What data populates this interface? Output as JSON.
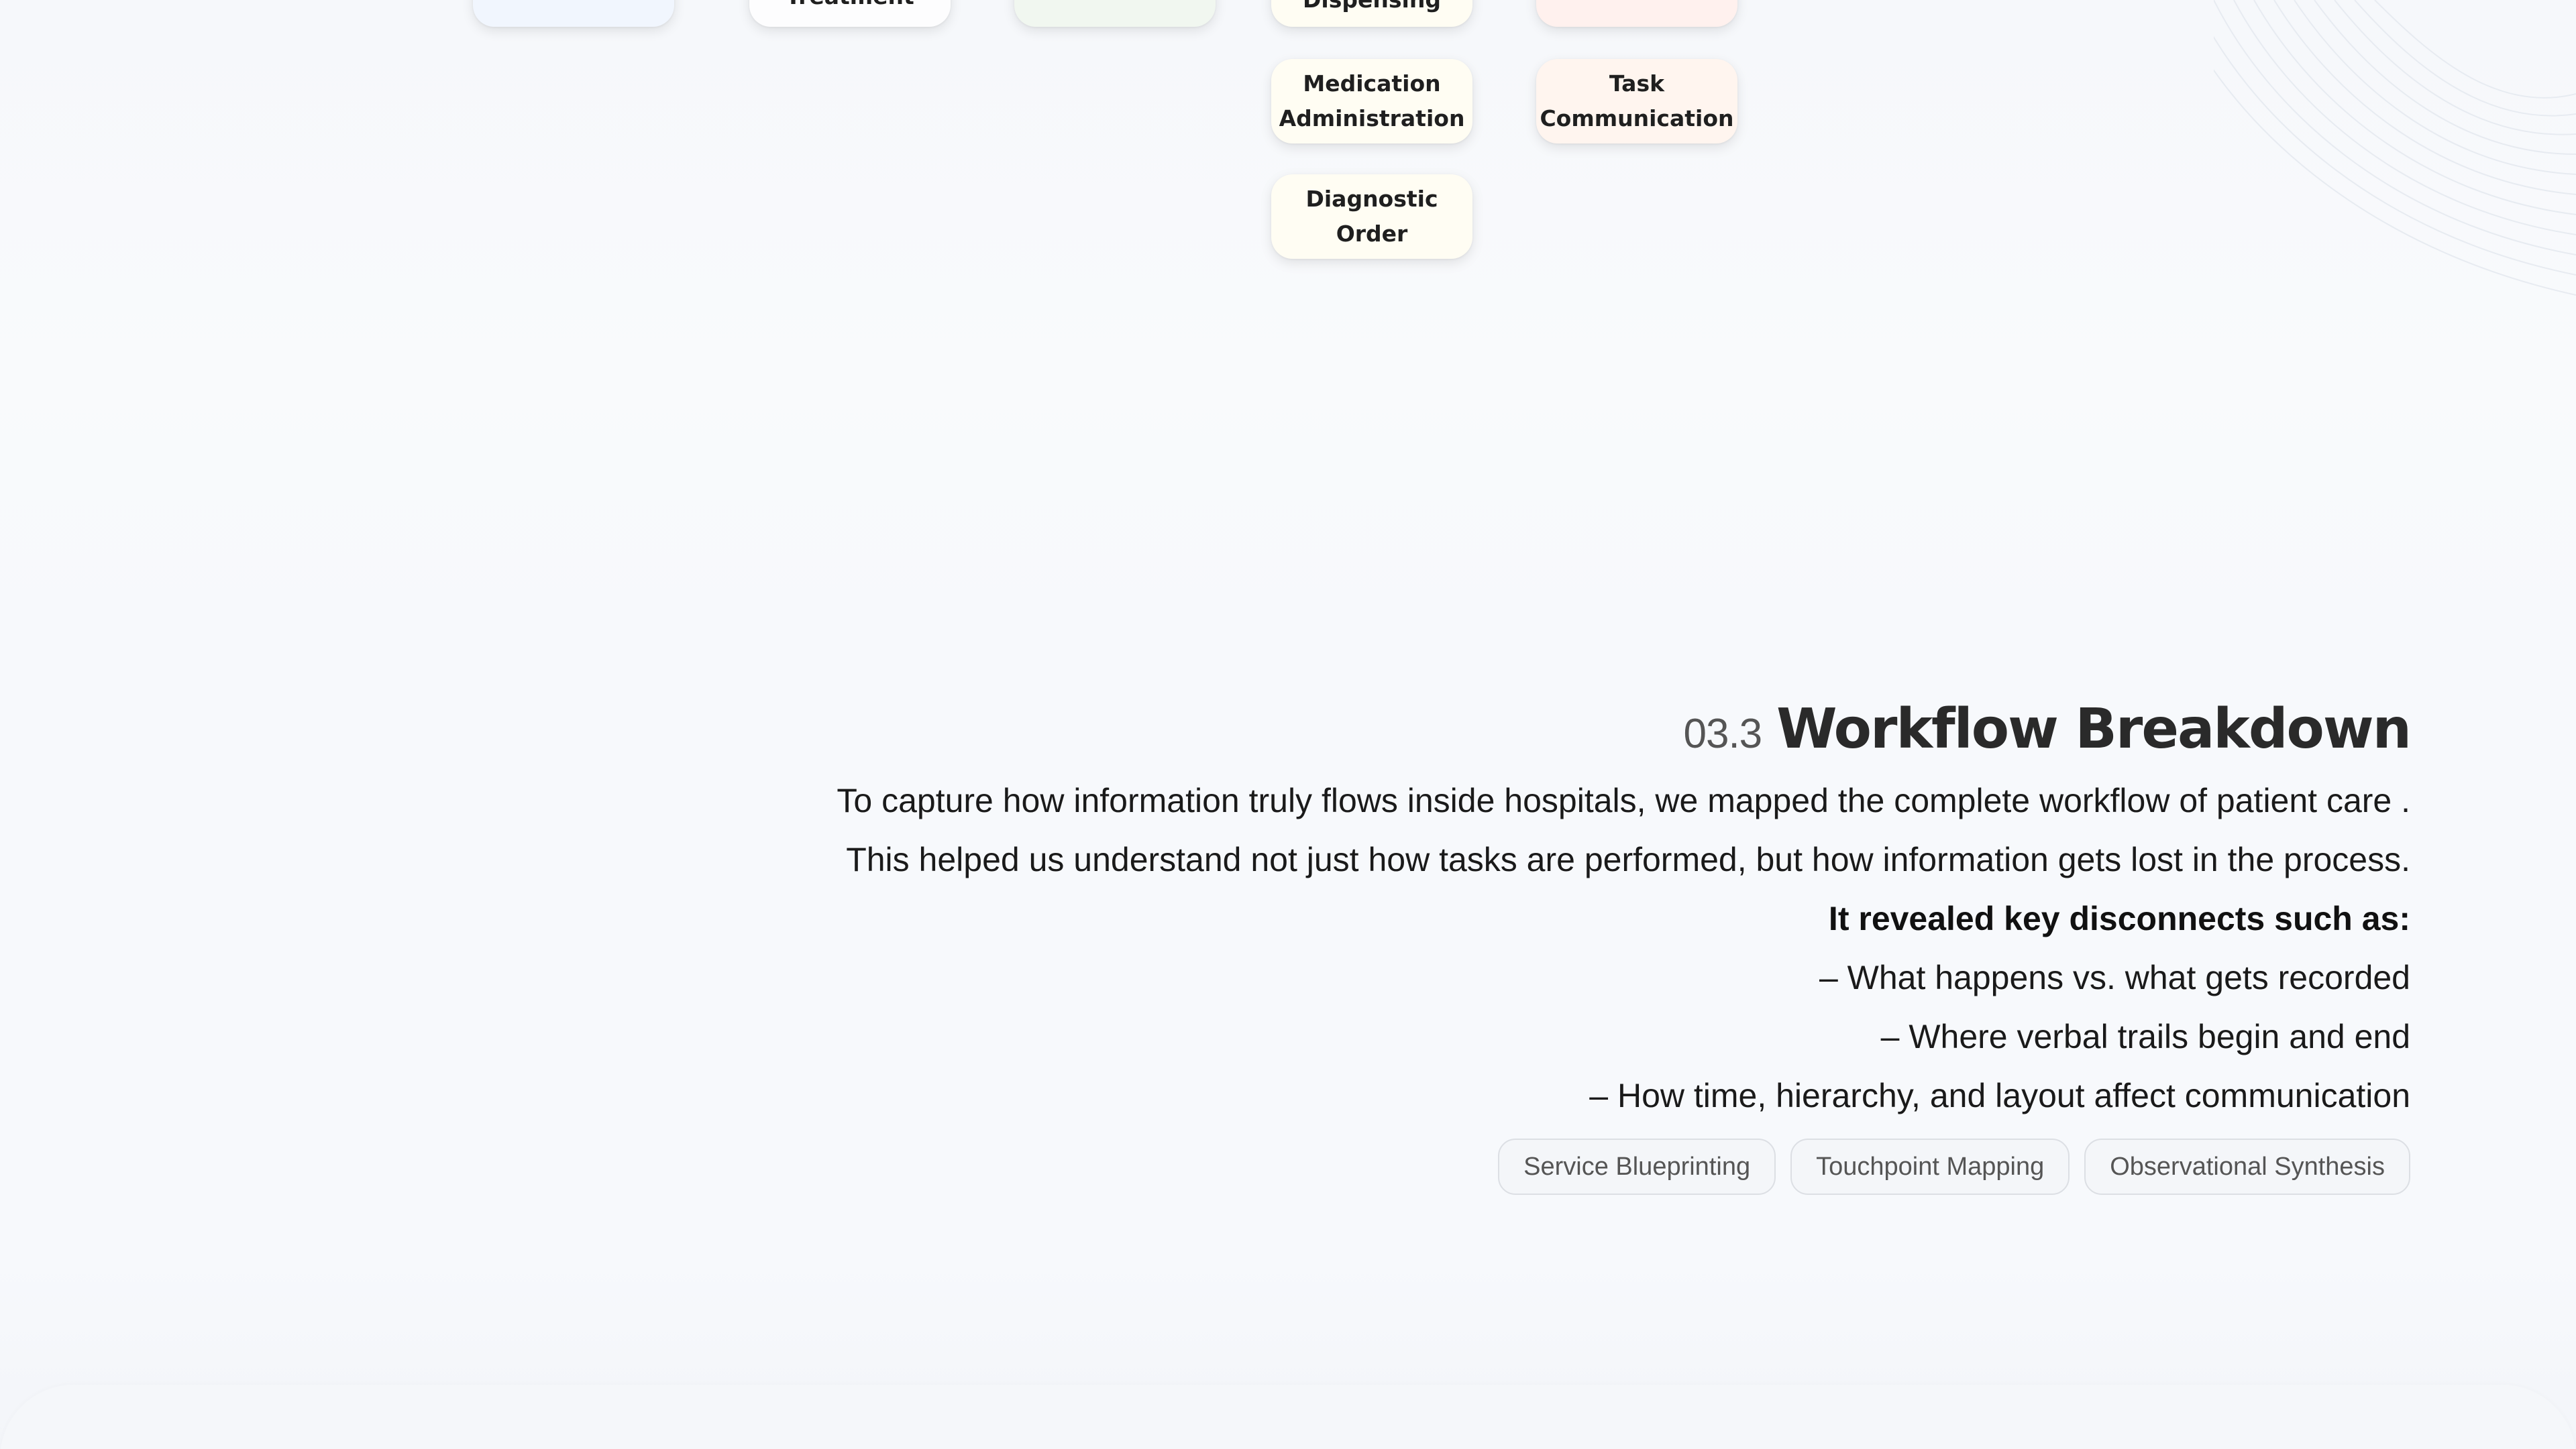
{
  "workflow_nodes": {
    "col1_top": "",
    "treatment": "Treatment",
    "col3_top": "",
    "dispensing": "Dispensing",
    "col5_top": "",
    "medication_administration": "Medication\nAdministration",
    "task_communication": "Task\nCommunication",
    "diagnostic_order": "Diagnostic\nOrder"
  },
  "section": {
    "number": "03.3",
    "title": "Workflow Breakdown",
    "lines": [
      "To capture how information truly flows inside hospitals, we mapped the complete workflow of patient care .",
      "This helped us understand not just how tasks are performed, but how information gets lost in the process."
    ],
    "emphasis": "It revealed key disconnects such as:",
    "bullets": [
      "– What happens vs. what gets recorded",
      "– Where verbal trails begin and end",
      "– How time, hierarchy, and layout affect communication"
    ],
    "tags": [
      "Service Blueprinting",
      "Touchpoint Mapping",
      "Observational Synthesis"
    ]
  }
}
